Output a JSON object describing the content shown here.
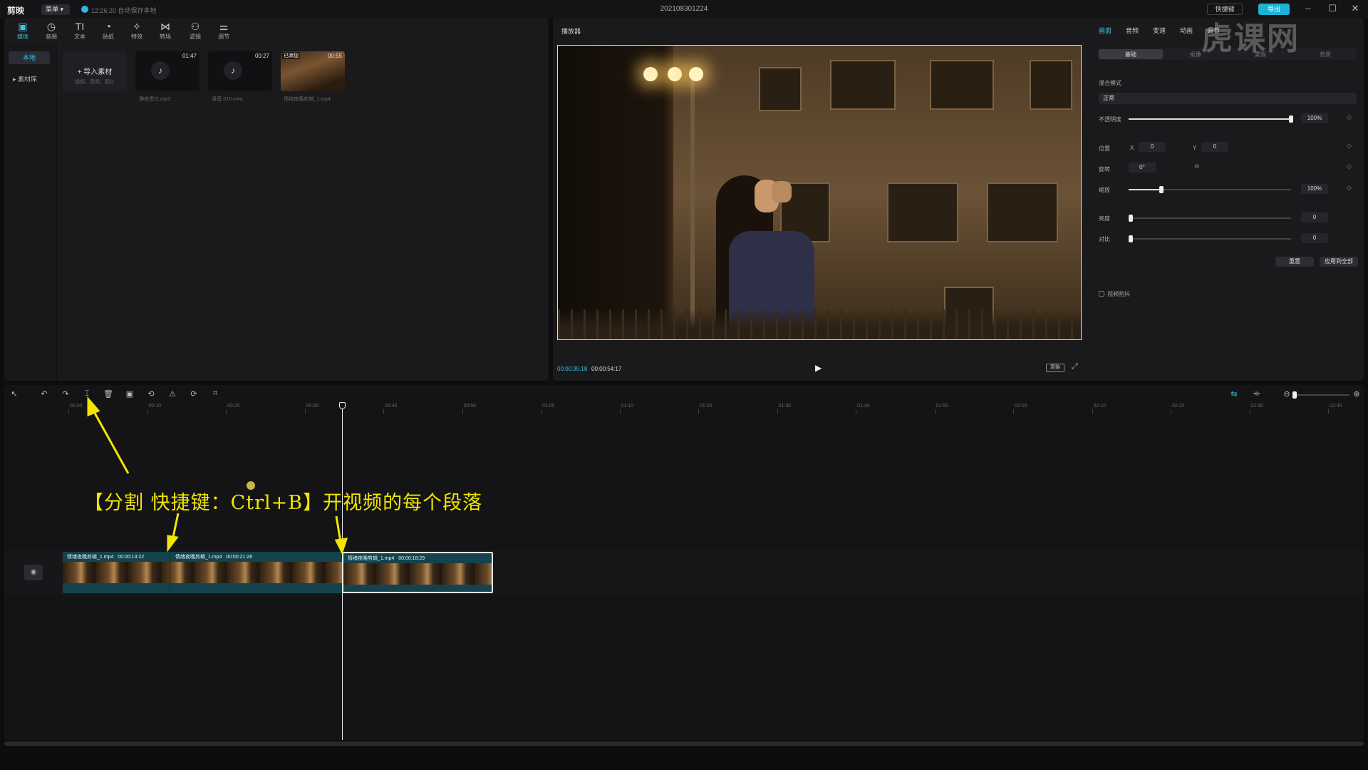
{
  "titlebar": {
    "app_name": "剪映",
    "menu_label": "菜单",
    "save_status": "12:26:20 自动保存本地",
    "project_title": "202108301224",
    "shortcut_label": "快捷键",
    "export_label": "导出",
    "min": "–",
    "max": "☐",
    "close": "✕"
  },
  "media": {
    "tools": [
      {
        "label": "媒体",
        "icon": "▣"
      },
      {
        "label": "音频",
        "icon": "◷"
      },
      {
        "label": "文本",
        "icon": "TI"
      },
      {
        "label": "贴纸",
        "icon": "◔"
      },
      {
        "label": "特效",
        "icon": "✧"
      },
      {
        "label": "转场",
        "icon": "⋈"
      },
      {
        "label": "滤镜",
        "icon": "⚇"
      },
      {
        "label": "调节",
        "icon": "⚌"
      }
    ],
    "side_local": "本地",
    "side_library": "▸ 素材库",
    "import_label": "+ 导入素材",
    "import_sub": "视频、音频、图片",
    "cards": [
      {
        "duration": "01:47",
        "name": "静夜思忆.mp3"
      },
      {
        "duration": "00:27",
        "name": "录音 010.m4a"
      },
      {
        "duration": "00:55",
        "name": "情绪夜晚剪辑_1.mp4",
        "tag": "已添加"
      }
    ]
  },
  "player": {
    "title": "播放器",
    "time_current": "00:00:35:18",
    "time_total": "00:00:54:17",
    "ratio_label": "原始"
  },
  "props": {
    "tabs": [
      "画面",
      "音频",
      "变速",
      "动画",
      "调节"
    ],
    "subtabs": [
      "基础",
      "抠像",
      "蒙版",
      "背景"
    ],
    "blend_label": "混合模式",
    "blend_value": "正常",
    "opacity_label": "不透明度",
    "opacity_value": "100%",
    "opacity_level": 1.0,
    "position_label": "位置",
    "pos_x_label": "X",
    "pos_x_value": "0",
    "pos_y_label": "Y",
    "pos_y_value": "0",
    "rotate_label": "旋转",
    "rotate_value": "0°",
    "scale_label": "缩放",
    "scale_value": "100%",
    "scale_level": 0.2,
    "brightness_label": "亮度",
    "brightness_value": "0",
    "contrast_label": "对比",
    "contrast_value": "0",
    "reset_label": "重置",
    "apply_all_label": "应用到全部",
    "stabilize_label": "视频防抖"
  },
  "timeline": {
    "ticks": [
      "00:00",
      "00:10",
      "00:20",
      "00:30",
      "00:40",
      "00:50",
      "01:00",
      "01:10",
      "01:20",
      "01:30",
      "01:40",
      "01:50",
      "02:00",
      "02:10",
      "02:20",
      "02:30",
      "02:40"
    ],
    "clips": [
      {
        "name": "情绪夜晚剪辑_1.mp4",
        "duration": "00:00:13:22"
      },
      {
        "name": "情绪夜晚剪辑_1.mp4",
        "duration": "00:00:21:26"
      },
      {
        "name": "情绪夜晚剪辑_1.mp4",
        "duration": "00:00:18:29"
      }
    ]
  },
  "annotation": {
    "text": "【分割 快捷键：Ctrl+B】开视频的每个段落",
    "color": "#f2e600"
  },
  "watermark": "虎课网",
  "colors": {
    "accent": "#38c6e0",
    "clip": "#14434d"
  }
}
